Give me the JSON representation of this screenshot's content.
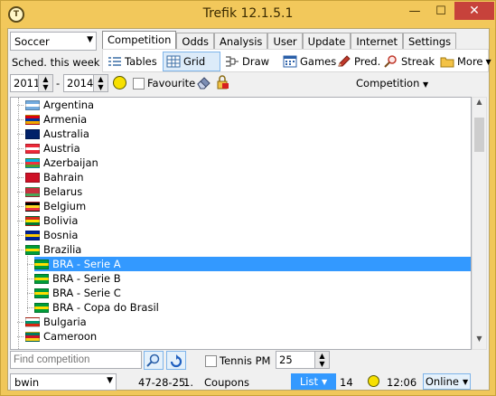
{
  "window": {
    "title": "Trefik 12.1.5.1",
    "icon": "trefik-logo-icon",
    "minimize_glyph": "—",
    "maximize_glyph": "☐",
    "close_glyph": "✕"
  },
  "sport_select": {
    "value": "Soccer"
  },
  "schedule_select": {
    "value": "Sched. this week"
  },
  "tabs": [
    {
      "label": "Competition",
      "active": true
    },
    {
      "label": "Odds"
    },
    {
      "label": "Analysis"
    },
    {
      "label": "User"
    },
    {
      "label": "Update"
    },
    {
      "label": "Internet"
    },
    {
      "label": "Settings"
    }
  ],
  "toolbar": {
    "tables": "Tables",
    "grid": "Grid",
    "draw": "Draw",
    "games": "Games",
    "pred": "Pred.",
    "streak": "Streak",
    "more": "More"
  },
  "filter": {
    "year_from": "2011",
    "year_to": "2014",
    "dash": "-",
    "favourite_label": "Favourite",
    "competition_dropdown": "Competition"
  },
  "tree": {
    "countries": [
      {
        "label": "Argentina",
        "flag": [
          "#74acdf",
          "#ffffff",
          "#74acdf"
        ]
      },
      {
        "label": "Armenia",
        "flag": [
          "#d90012",
          "#0033a0",
          "#f2a800"
        ]
      },
      {
        "label": "Australia",
        "flag": [
          "#012169",
          "#012169",
          "#012169"
        ]
      },
      {
        "label": "Austria",
        "flag": [
          "#ed2939",
          "#ffffff",
          "#ed2939"
        ]
      },
      {
        "label": "Azerbaijan",
        "flag": [
          "#00b5e2",
          "#ef3340",
          "#509e2f"
        ]
      },
      {
        "label": "Bahrain",
        "flag": [
          "#ce1126",
          "#ce1126",
          "#ce1126"
        ]
      },
      {
        "label": "Belarus",
        "flag": [
          "#c8313e",
          "#c8313e",
          "#4aa657"
        ]
      },
      {
        "label": "Belgium",
        "flag": [
          "#000000",
          "#fdda24",
          "#ef3340"
        ]
      },
      {
        "label": "Bolivia",
        "flag": [
          "#d52b1e",
          "#f9e300",
          "#007934"
        ]
      },
      {
        "label": "Bosnia",
        "flag": [
          "#002395",
          "#fecb00",
          "#002395"
        ]
      },
      {
        "label": "Brazilia",
        "flag": [
          "#009c3b",
          "#ffdf00",
          "#009c3b"
        ]
      }
    ],
    "competitions": [
      {
        "label": "BRA - Serie A",
        "selected": true
      },
      {
        "label": "BRA - Serie B"
      },
      {
        "label": "BRA - Serie C"
      },
      {
        "label": "BRA - Copa do Brasil"
      }
    ],
    "more_countries": [
      {
        "label": "Bulgaria",
        "flag": [
          "#ffffff",
          "#00966e",
          "#d62612"
        ]
      },
      {
        "label": "Cameroon",
        "flag": [
          "#007a5e",
          "#ce1126",
          "#fcd116"
        ]
      }
    ]
  },
  "search": {
    "placeholder": "Find competition",
    "tennis_pm_label": "Tennis PM",
    "count_value": "25"
  },
  "status_bar": {
    "bookmaker": "bwin",
    "record": "47-28-25",
    "rank": "1.",
    "coupons_label": "Coupons",
    "list_label": "List",
    "number": "14",
    "time": "12:06",
    "online_label": "Online"
  },
  "colors": {
    "titlebar": "#f2c85b",
    "selection": "#3399ff",
    "close_button": "#c7423b"
  }
}
